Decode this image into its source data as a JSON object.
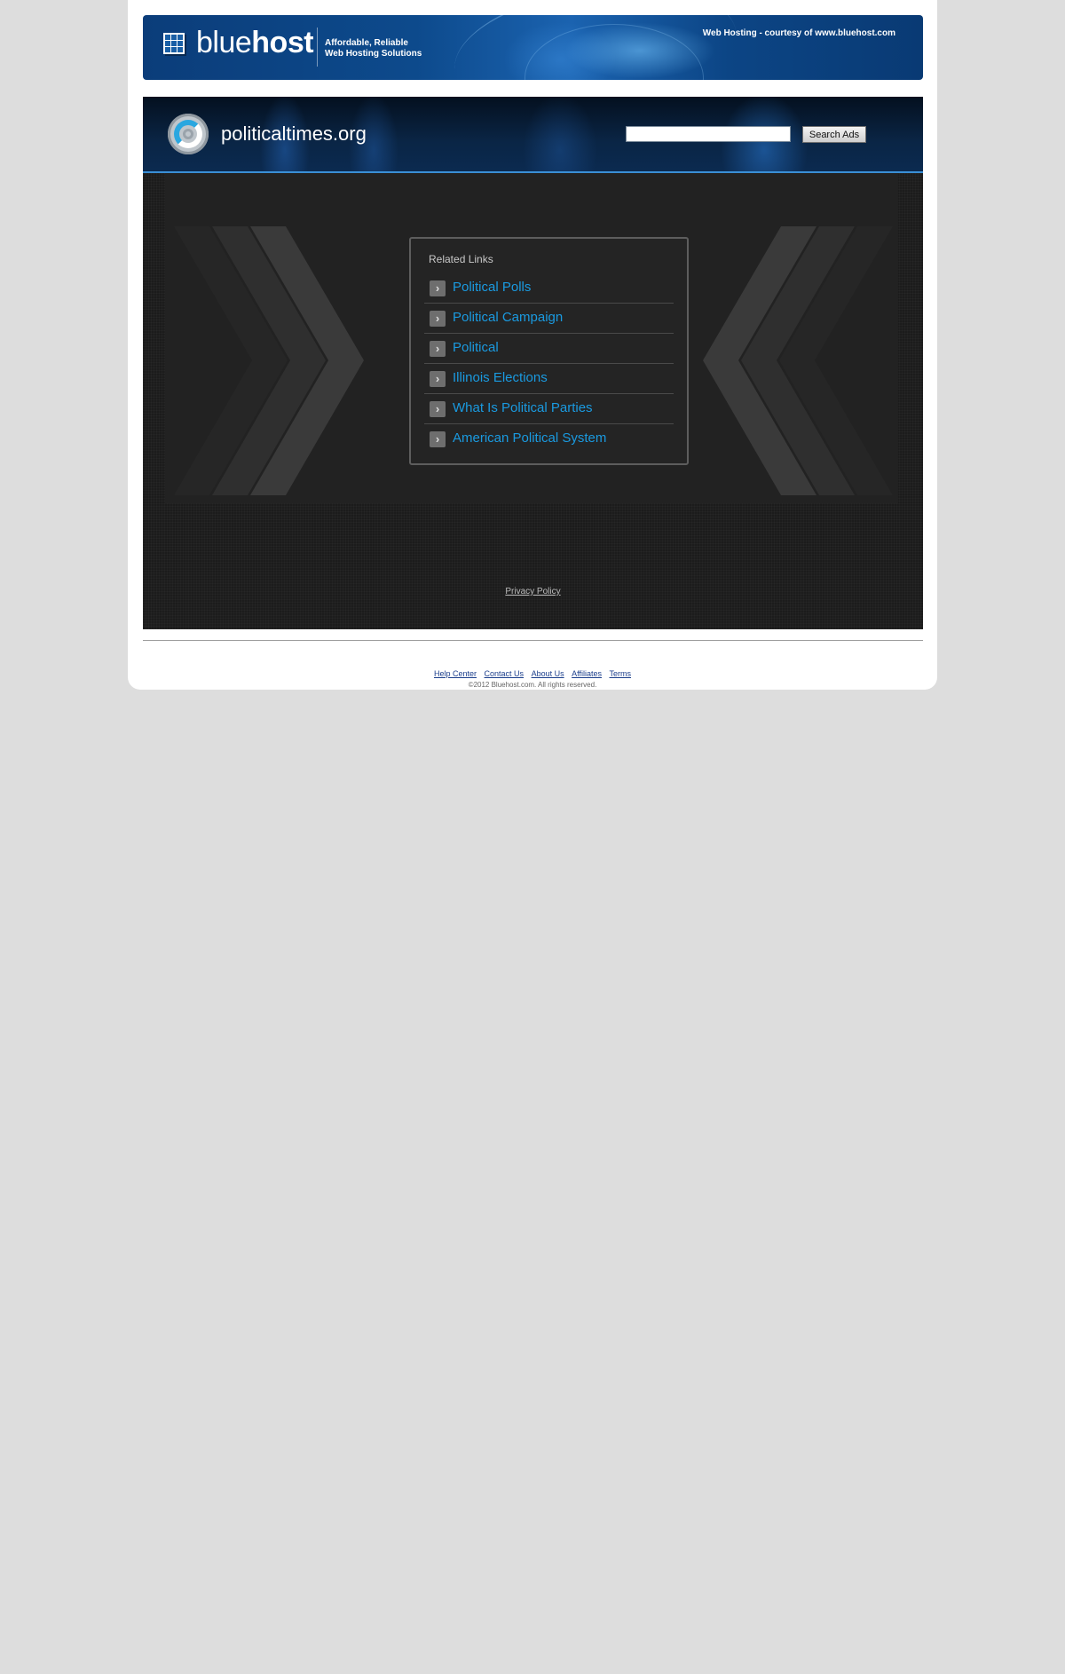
{
  "banner": {
    "brand_light": "blue",
    "brand_bold": "host",
    "tagline_line1": "Affordable, Reliable",
    "tagline_line2": "Web Hosting Solutions",
    "courtesy": "Web Hosting - courtesy of www.bluehost.com",
    "icon": "grid-logo-icon",
    "color": "#0d4a8c"
  },
  "header": {
    "site_name": "politicaltimes.org",
    "logo_icon": "target-logo-icon",
    "search_placeholder": "",
    "search_value": "",
    "search_button_label": "Search Ads",
    "accent_color": "#3a8fd6"
  },
  "related": {
    "title": "Related Links",
    "arrow_icon": "chevron-right-icon",
    "link_color": "#1a9ae0",
    "links": [
      {
        "label": "Political Polls"
      },
      {
        "label": "Political Campaign"
      },
      {
        "label": "Political"
      },
      {
        "label": "Illinois Elections"
      },
      {
        "label": "What Is Political Parties"
      },
      {
        "label": "American Political System"
      }
    ]
  },
  "privacy_label": "Privacy Policy",
  "footer": {
    "links": [
      "Help Center",
      "Contact Us",
      "About Us",
      "Affiliates",
      "Terms"
    ],
    "copyright": "©2012 Bluehost.com. All rights reserved."
  }
}
